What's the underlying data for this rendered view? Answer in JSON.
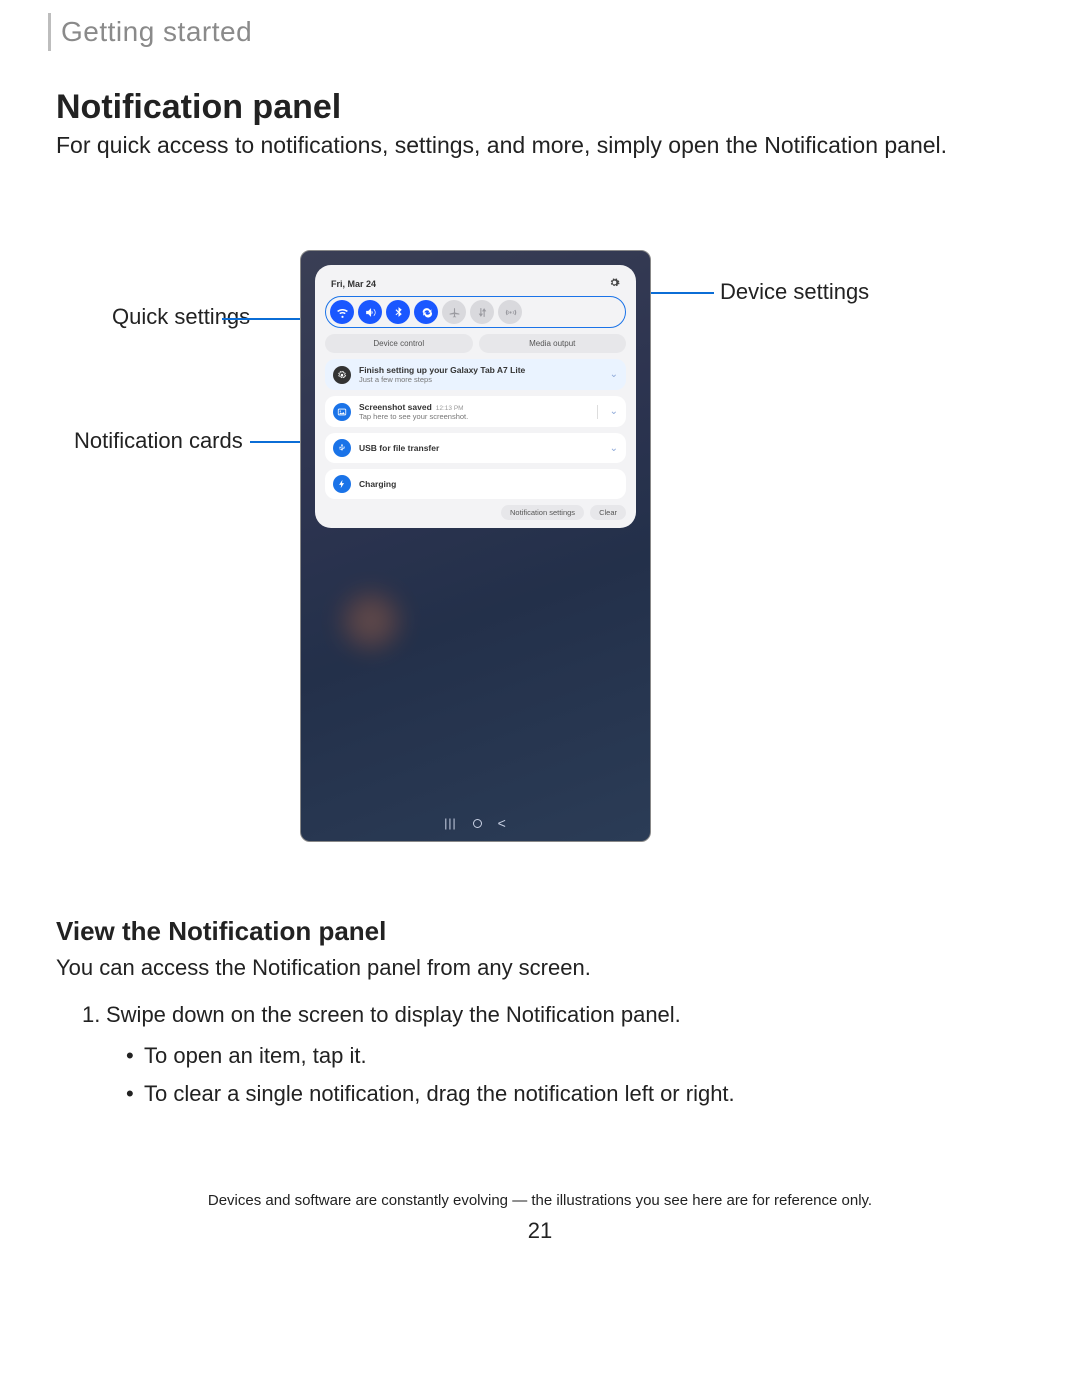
{
  "header": {
    "section": "Getting started"
  },
  "h2": "Notification panel",
  "intro": "For quick access to notifications, settings, and more, simply open the Notification panel.",
  "callouts": {
    "quick_settings": "Quick settings",
    "notification_cards": "Notification cards",
    "device_settings": "Device settings"
  },
  "device": {
    "date": "Fri, Mar 24",
    "quick_toggles": [
      {
        "name": "wifi",
        "on": true
      },
      {
        "name": "sound",
        "on": true
      },
      {
        "name": "bluetooth",
        "on": true
      },
      {
        "name": "rotate",
        "on": true
      },
      {
        "name": "airplane",
        "on": false
      },
      {
        "name": "data",
        "on": false
      },
      {
        "name": "hotspot",
        "on": false
      }
    ],
    "buttons": {
      "device_control": "Device control",
      "media_output": "Media output"
    },
    "cards": [
      {
        "icon": "gear",
        "tint": true,
        "title": "Finish setting up your Galaxy Tab A7 Lite",
        "sub": "Just a few more steps"
      },
      {
        "icon": "image",
        "tint": false,
        "title": "Screenshot saved",
        "time": "12:13 PM",
        "sub": "Tap here to see your screenshot.",
        "splitchev": true
      },
      {
        "icon": "usb",
        "tint": false,
        "title": "USB for file transfer"
      },
      {
        "icon": "bolt",
        "tint": false,
        "title": "Charging"
      }
    ],
    "footer": {
      "settings": "Notification settings",
      "clear": "Clear"
    }
  },
  "h3": "View the Notification panel",
  "p2": "You can access the Notification panel from any screen.",
  "steps": {
    "s1": "Swipe down on the screen to display the Notification panel.",
    "b1": "To open an item, tap it.",
    "b2": "To clear a single notification, drag the notification left or right."
  },
  "footer_note": "Devices and software are constantly evolving — the illustrations you see here are for reference only.",
  "page_number": "21"
}
